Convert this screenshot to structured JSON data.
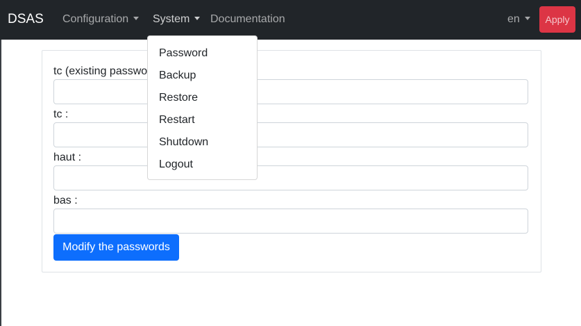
{
  "navbar": {
    "brand": "DSAS",
    "menus": [
      {
        "label": "Configuration"
      },
      {
        "label": "System"
      },
      {
        "label": "Documentation"
      }
    ],
    "language": "en",
    "apply_label": "Apply"
  },
  "system_menu": {
    "items": [
      {
        "label": "Password"
      },
      {
        "label": "Backup"
      },
      {
        "label": "Restore"
      },
      {
        "label": "Restart"
      },
      {
        "label": "Shutdown"
      },
      {
        "label": "Logout"
      }
    ]
  },
  "password_form": {
    "fields": [
      {
        "label": "tc (existing password) :",
        "value": ""
      },
      {
        "label": "tc :",
        "value": ""
      },
      {
        "label": "haut :",
        "value": ""
      },
      {
        "label": "bas :",
        "value": ""
      }
    ],
    "submit_label": "Modify the passwords"
  },
  "colors": {
    "navbar_bg": "#212529",
    "apply_button": "#dc3545",
    "primary_button": "#0d6efd"
  }
}
